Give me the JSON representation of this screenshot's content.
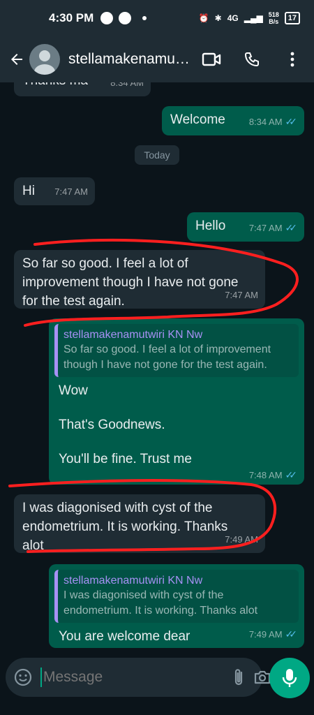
{
  "status_bar": {
    "time": "4:30 PM",
    "network": "4G",
    "speed_value": "518",
    "speed_unit": "B/s",
    "battery": "17"
  },
  "header": {
    "contact_name": "stellamakenamu…"
  },
  "chat": {
    "date_chip": "Today",
    "messages": [
      {
        "text": "Thanks ma",
        "time": "8:34 AM"
      },
      {
        "text": "Welcome",
        "time": "8:34 AM"
      },
      {
        "text": "Hi",
        "time": "7:47 AM"
      },
      {
        "text": "Hello",
        "time": "7:47 AM"
      },
      {
        "text": "So far so good. I feel a lot of improvement though I have not gone for the test again.",
        "time": "7:47 AM"
      },
      {
        "quote_author": "stellamakenamutwiri KN Nw",
        "quote_text": "So far so good. I feel a lot of improvement though I have not gone for the test again.",
        "line1": "Wow",
        "line2": "That's Goodnews.",
        "line3": "You'll be fine. Trust me",
        "time": "7:48 AM"
      },
      {
        "text": "I was diagonised with cyst of the endometrium.  It is working. Thanks alot",
        "time": "7:49 AM"
      },
      {
        "quote_author": "stellamakenamutwiri KN Nw",
        "quote_text": "I was diagonised with cyst of the endometrium.  It is working. Thanks alot",
        "text": "You are welcome dear",
        "time": "7:49 AM"
      }
    ]
  },
  "composer": {
    "placeholder": "Message"
  },
  "colors": {
    "accent": "#00a884",
    "incoming": "#1f2c34",
    "outgoing": "#005c4b",
    "annotation": "#ff1f1f"
  }
}
